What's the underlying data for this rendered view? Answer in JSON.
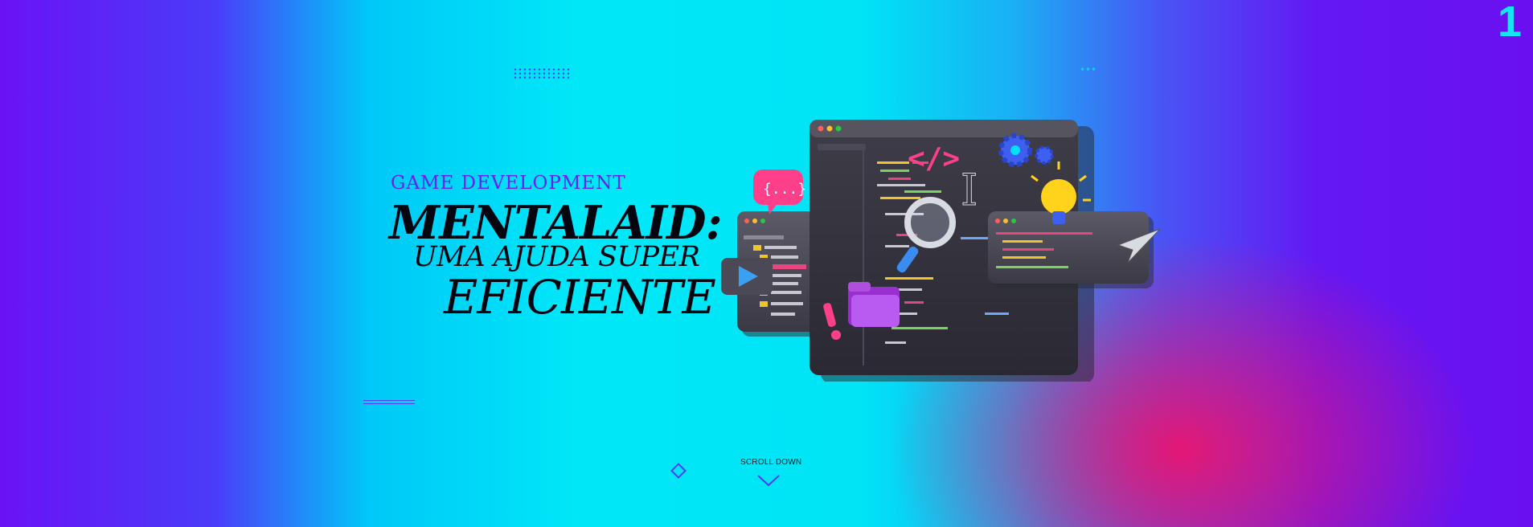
{
  "slide": {
    "number": "1"
  },
  "hero": {
    "kicker": "GAME DEVELOPMENT",
    "title_line1": "MENTALAID:",
    "title_line2": "UMA AJUDA SUPER",
    "title_line3": "EFICIENTE"
  },
  "scroll": {
    "label": "SCROLL DOWN"
  },
  "colors": {
    "accent_purple": "#6b1ff0",
    "cyan": "#00e8f8",
    "magenta": "#ec146e",
    "text_dark": "#050510"
  },
  "illustration": {
    "icons": [
      "code-brackets-icon",
      "magnifier-icon",
      "folder-icon",
      "gear-icon",
      "lightbulb-icon",
      "cursor-arrow-icon",
      "play-icon",
      "text-cursor-icon",
      "exclamation-icon",
      "chat-bubble-icon"
    ]
  }
}
